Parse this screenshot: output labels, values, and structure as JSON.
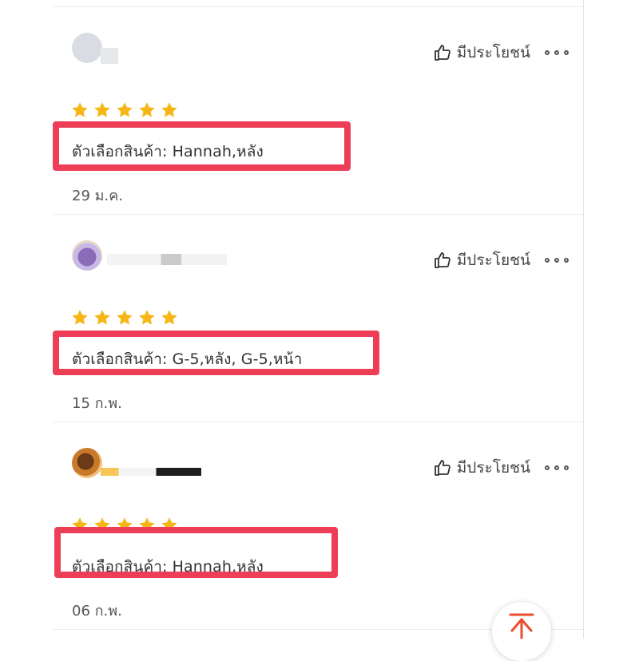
{
  "helpful_label": "มีประโยชน์",
  "reviews": [
    {
      "rating": 5,
      "variant_text": "ตัวเลือกสินค้า: Hannah,หลัง",
      "date": "29 ม.ค."
    },
    {
      "rating": 5,
      "variant_text": "ตัวเลือกสินค้า: G-5,หลัง, G-5,หน้า",
      "date": "15 ก.พ."
    },
    {
      "rating": 5,
      "variant_text": "ตัวเลือกสินค้า: Hannah,หลัง",
      "date": "06 ก.พ."
    }
  ],
  "icons": {
    "helpful": "thumbs-up-icon",
    "more": "more-options-icon",
    "star": "star-icon",
    "scroll_top": "scroll-to-top-icon"
  },
  "colors": {
    "star": "#f6b716",
    "highlight": "#ee3d57",
    "scroll_top_arrow": "#ee4d2d"
  }
}
